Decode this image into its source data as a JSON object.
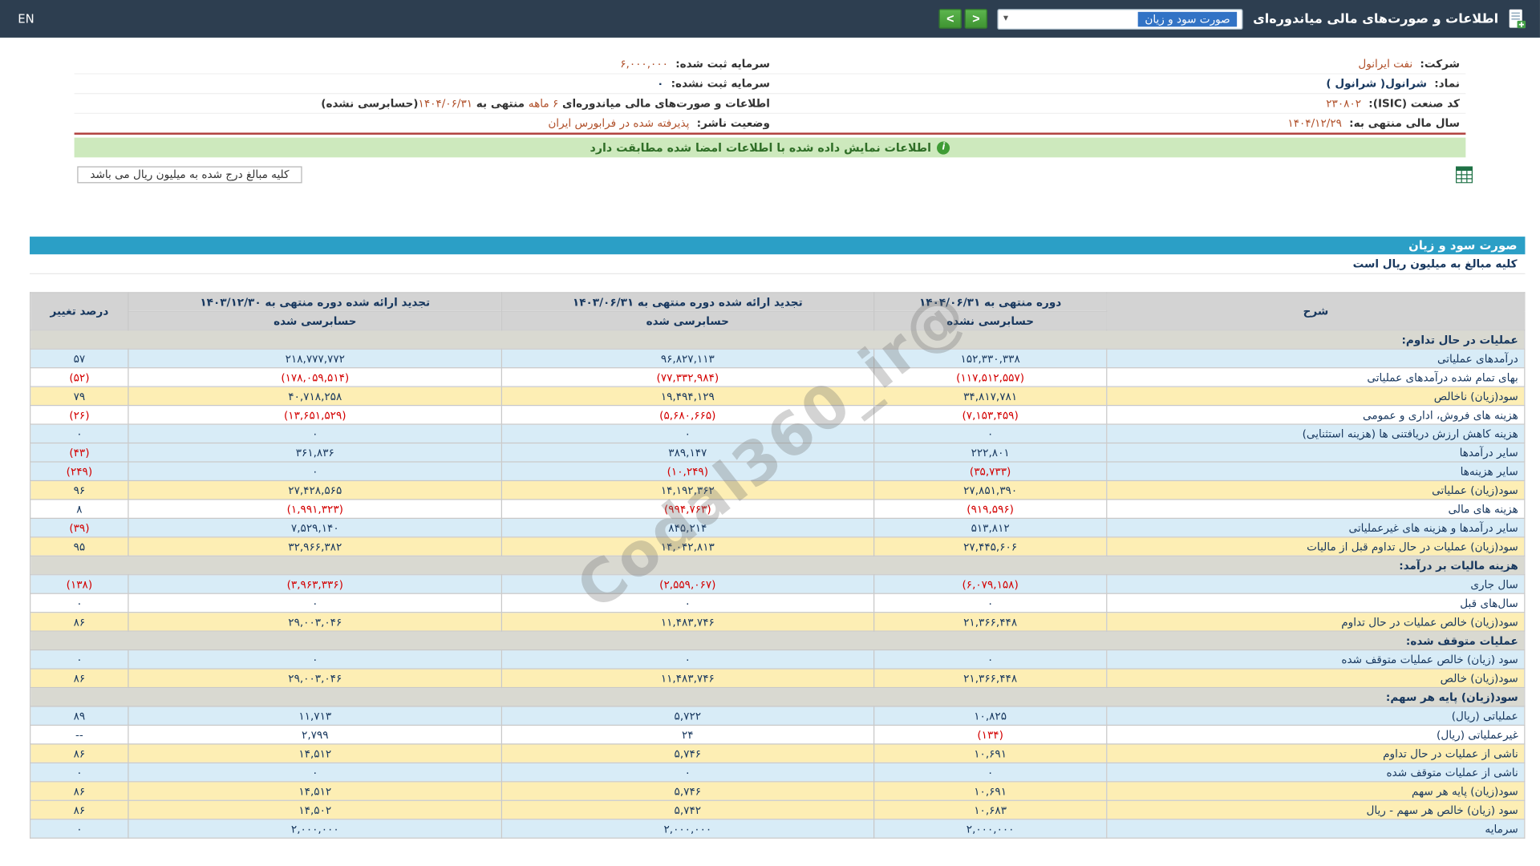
{
  "watermark": "@Codal360_ir",
  "topbar": {
    "title": "اطلاعات و صورت‌های مالی میاندوره‌ای",
    "statement_dropdown": "صورت سود و زیان",
    "prev_label": "<",
    "next_label": ">",
    "lang": "EN"
  },
  "company": {
    "company_label": "شرکت:",
    "company_value": "نفت ایرانول",
    "symbol_label": "نماد:",
    "symbol_value": "شرانول( شرانول )",
    "isic_label": "کد صنعت (ISIC):",
    "isic_value": "۲۳۰۸۰۲",
    "fiscal_label": "سال مالی منتهی به:",
    "fiscal_value": "۱۴۰۴/۱۲/۲۹",
    "registered_capital_label": "سرمایه ثبت شده:",
    "registered_capital_value": "۶,۰۰۰,۰۰۰",
    "unregistered_capital_label": "سرمایه ثبت نشده:",
    "unregistered_capital_value": "۰",
    "period_info_prefix": "اطلاعات و صورت‌های مالی میاندوره‌ای ",
    "period_length": "۶ ماهه",
    "period_info_mid": " منتهی به ",
    "period_end_date": "۱۴۰۴/۰۶/۳۱",
    "period_info_suffix": "(حسابرسی نشده)",
    "publisher_status_label": "وضعیت ناشر:",
    "publisher_status_value": "پذیرفته شده در فرابورس ایران"
  },
  "alert": {
    "text": "اطلاعات نمایش داده شده با اطلاعات امضا شده مطابقت دارد"
  },
  "note_box": "کلیه مبالغ درج شده به میلیون ریال می باشد",
  "statement": {
    "title": "صورت سود و زیان",
    "unit_note": "کلیه مبالغ به میلیون ریال است",
    "header": {
      "desc": "شرح",
      "periods": [
        {
          "title": "دوره منتهی به ۱۴۰۴/۰۶/۳۱",
          "audit": "حسابرسی نشده"
        },
        {
          "title": "تجدید ارائه شده دوره منتهی به ۱۴۰۳/۰۶/۳۱",
          "audit": "حسابرسی شده"
        },
        {
          "title": "تجدید ارائه شده دوره منتهی به ۱۴۰۳/۱۲/۳۰",
          "audit": "حسابرسی شده"
        }
      ],
      "change": "درصد تغییر"
    },
    "rows": [
      {
        "type": "section",
        "label": "عملیات در حال تداوم:"
      },
      {
        "type": "data",
        "label": "درآمدهای عملیاتی",
        "v": [
          "۱۵۲,۳۳۰,۳۳۸",
          "۹۶,۸۲۷,۱۱۳",
          "۲۱۸,۷۷۷,۷۷۲"
        ],
        "chg": "۵۷",
        "bg": "blue"
      },
      {
        "type": "data",
        "label": "بهای تمام شده درآمدهای عملیاتی",
        "v": [
          "(۱۱۷,۵۱۲,۵۵۷)",
          "(۷۷,۳۳۲,۹۸۴)",
          "(۱۷۸,۰۵۹,۵۱۴)"
        ],
        "chg": "(۵۲)",
        "bg": "white"
      },
      {
        "type": "data",
        "label": "سود(زیان) ناخالص",
        "v": [
          "۳۴,۸۱۷,۷۸۱",
          "۱۹,۴۹۴,۱۲۹",
          "۴۰,۷۱۸,۲۵۸"
        ],
        "chg": "۷۹",
        "bg": "yellow"
      },
      {
        "type": "data",
        "label": "هزینه های فروش، اداری و عمومی",
        "v": [
          "(۷,۱۵۳,۴۵۹)",
          "(۵,۶۸۰,۶۶۵)",
          "(۱۳,۶۵۱,۵۲۹)"
        ],
        "chg": "(۲۶)",
        "bg": "white"
      },
      {
        "type": "data",
        "label": "هزینه کاهش ارزش دریافتنی ها (هزینه استثنایی)",
        "v": [
          "۰",
          "۰",
          "۰"
        ],
        "chg": "۰",
        "bg": "blue"
      },
      {
        "type": "data",
        "label": "سایر درآمدها",
        "v": [
          "۲۲۲,۸۰۱",
          "۳۸۹,۱۴۷",
          "۳۶۱,۸۳۶"
        ],
        "chg": "(۴۳)",
        "bg": "blue"
      },
      {
        "type": "data",
        "label": "سایر هزینه‌ها",
        "v": [
          "(۳۵,۷۳۳)",
          "(۱۰,۲۴۹)",
          "۰"
        ],
        "chg": "(۲۴۹)",
        "bg": "blue"
      },
      {
        "type": "data",
        "label": "سود(زیان) عملیاتی",
        "v": [
          "۲۷,۸۵۱,۳۹۰",
          "۱۴,۱۹۲,۳۶۲",
          "۲۷,۴۲۸,۵۶۵"
        ],
        "chg": "۹۶",
        "bg": "yellow"
      },
      {
        "type": "data",
        "label": "هزینه های مالی",
        "v": [
          "(۹۱۹,۵۹۶)",
          "(۹۹۴,۷۶۳)",
          "(۱,۹۹۱,۳۲۳)"
        ],
        "chg": "۸",
        "bg": "white"
      },
      {
        "type": "data",
        "label": "سایر درآمدها و هزینه های غیرعملیاتی",
        "v": [
          "۵۱۳,۸۱۲",
          "۸۴۵,۲۱۴",
          "۷,۵۲۹,۱۴۰"
        ],
        "chg": "(۳۹)",
        "bg": "blue"
      },
      {
        "type": "data",
        "label": "سود(زیان) عملیات در حال تداوم قبل از مالیات",
        "v": [
          "۲۷,۴۴۵,۶۰۶",
          "۱۴,۰۴۲,۸۱۳",
          "۳۲,۹۶۶,۳۸۲"
        ],
        "chg": "۹۵",
        "bg": "yellow"
      },
      {
        "type": "section",
        "label": "هزینه مالیات بر درآمد:"
      },
      {
        "type": "data",
        "label": "سال جاری",
        "v": [
          "(۶,۰۷۹,۱۵۸)",
          "(۲,۵۵۹,۰۶۷)",
          "(۳,۹۶۳,۳۳۶)"
        ],
        "chg": "(۱۳۸)",
        "bg": "blue"
      },
      {
        "type": "data",
        "label": "سال‌های قبل",
        "v": [
          "۰",
          "۰",
          "۰"
        ],
        "chg": "۰",
        "bg": "white"
      },
      {
        "type": "data",
        "label": "سود(زیان) خالص عملیات در حال تداوم",
        "v": [
          "۲۱,۳۶۶,۴۴۸",
          "۱۱,۴۸۳,۷۴۶",
          "۲۹,۰۰۳,۰۴۶"
        ],
        "chg": "۸۶",
        "bg": "yellow"
      },
      {
        "type": "section",
        "label": "عملیات متوقف شده:"
      },
      {
        "type": "data",
        "label": "سود (زیان) خالص عملیات متوقف شده",
        "v": [
          "۰",
          "۰",
          "۰"
        ],
        "chg": "۰",
        "bg": "blue"
      },
      {
        "type": "data",
        "label": "سود(زیان) خالص",
        "v": [
          "۲۱,۳۶۶,۴۴۸",
          "۱۱,۴۸۳,۷۴۶",
          "۲۹,۰۰۳,۰۴۶"
        ],
        "chg": "۸۶",
        "bg": "yellow"
      },
      {
        "type": "section",
        "label": "سود(زیان) پایه هر سهم:"
      },
      {
        "type": "data",
        "label": "عملیاتی (ریال)",
        "v": [
          "۱۰,۸۲۵",
          "۵,۷۲۲",
          "۱۱,۷۱۳"
        ],
        "chg": "۸۹",
        "bg": "blue"
      },
      {
        "type": "data",
        "label": "غیرعملیاتی (ریال)",
        "v": [
          "(۱۳۴)",
          "۲۴",
          "۲,۷۹۹"
        ],
        "chg": "--",
        "bg": "white"
      },
      {
        "type": "data",
        "label": "ناشی از عملیات در حال تداوم",
        "v": [
          "۱۰,۶۹۱",
          "۵,۷۴۶",
          "۱۴,۵۱۲"
        ],
        "chg": "۸۶",
        "bg": "yellow"
      },
      {
        "type": "data",
        "label": "ناشی از عملیات متوقف شده",
        "v": [
          "۰",
          "۰",
          "۰"
        ],
        "chg": "۰",
        "bg": "blue"
      },
      {
        "type": "data",
        "label": "سود(زیان) پایه هر سهم",
        "v": [
          "۱۰,۶۹۱",
          "۵,۷۴۶",
          "۱۴,۵۱۲"
        ],
        "chg": "۸۶",
        "bg": "yellow"
      },
      {
        "type": "data",
        "label": "سود (زیان) خالص هر سهم - ریال",
        "v": [
          "۱۰,۶۸۳",
          "۵,۷۴۲",
          "۱۴,۵۰۲"
        ],
        "chg": "۸۶",
        "bg": "yellow"
      },
      {
        "type": "data",
        "label": "سرمایه",
        "v": [
          "۲,۰۰۰,۰۰۰",
          "۲,۰۰۰,۰۰۰",
          "۲,۰۰۰,۰۰۰"
        ],
        "chg": "۰",
        "bg": "blue"
      }
    ]
  },
  "icons": {
    "topbar_icon": "financial-report-icon",
    "select_caret": "chevron-down-icon",
    "alert_icon": "info-icon",
    "export_icon": "excel-export-icon"
  },
  "colors": {
    "topbar_bg": "#2d3e50",
    "accent_value": "#b0502a",
    "statement_title_bg": "#2b9fc6",
    "row_highlight_yellow": "#fdeeb4",
    "row_highlight_blue": "#d8ecf7",
    "section_row_bg": "#d9d9d1",
    "header_cell_bg": "#d3d3d3",
    "negative_number": "#d30000",
    "number_text": "#17375e",
    "alert_bg": "#cde9bd",
    "alert_text": "#2f6e27",
    "nav_button_green": "#3f9432",
    "panel_divider_red": "#b0413e"
  }
}
